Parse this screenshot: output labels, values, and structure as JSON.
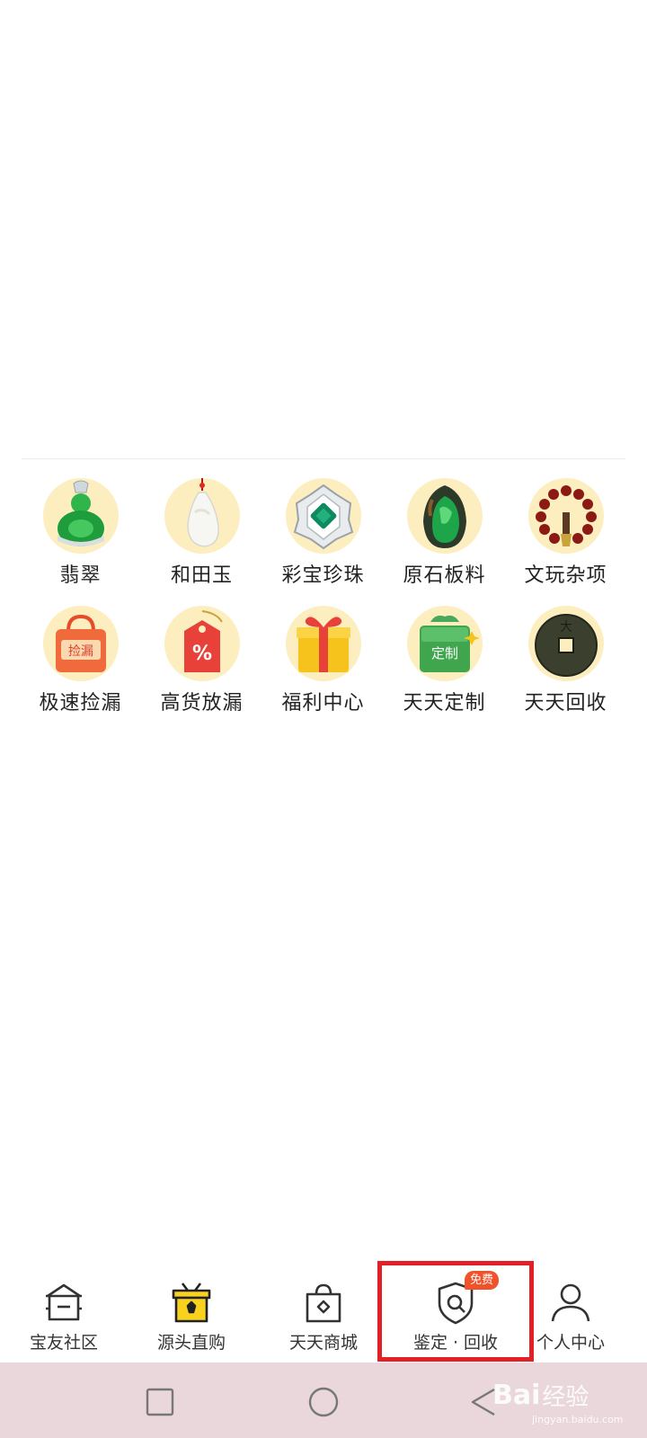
{
  "categories": [
    [
      {
        "label": "翡翠",
        "icon": "jade-buddha-icon"
      },
      {
        "label": "和田玉",
        "icon": "hetian-jade-pendant-icon"
      },
      {
        "label": "彩宝珍珠",
        "icon": "gem-ring-icon"
      },
      {
        "label": "原石板料",
        "icon": "raw-stone-icon"
      },
      {
        "label": "文玩杂项",
        "icon": "prayer-beads-icon"
      }
    ],
    [
      {
        "label": "极速捡漏",
        "icon": "shopping-bag-icon",
        "icon_text": "捡漏"
      },
      {
        "label": "高货放漏",
        "icon": "price-tag-icon",
        "icon_text": "%"
      },
      {
        "label": "福利中心",
        "icon": "gift-box-icon"
      },
      {
        "label": "天天定制",
        "icon": "custom-box-icon",
        "icon_text": "定制"
      },
      {
        "label": "天天回收",
        "icon": "ancient-coin-icon",
        "icon_text": "大"
      }
    ]
  ],
  "tabs": [
    {
      "label": "宝友社区",
      "icon": "community-house-icon"
    },
    {
      "label": "源头直购",
      "icon": "direct-purchase-icon"
    },
    {
      "label": "天天商城",
      "icon": "mall-bag-icon"
    },
    {
      "label": "鉴定 · 回收",
      "icon": "appraisal-shield-icon",
      "badge": "免费"
    },
    {
      "label": "个人中心",
      "icon": "user-profile-icon"
    }
  ],
  "system_nav": [
    "recent-apps-icon",
    "home-circle-icon",
    "back-triangle-icon"
  ],
  "watermark": {
    "brand": "Bai",
    "text": "经验",
    "sub": "jingyan.baidu.com"
  },
  "colors": {
    "icon_bg": "#fdeec0",
    "badge": "#f0522c",
    "highlight": "#e32026",
    "nav_bar": "#ead7db"
  }
}
